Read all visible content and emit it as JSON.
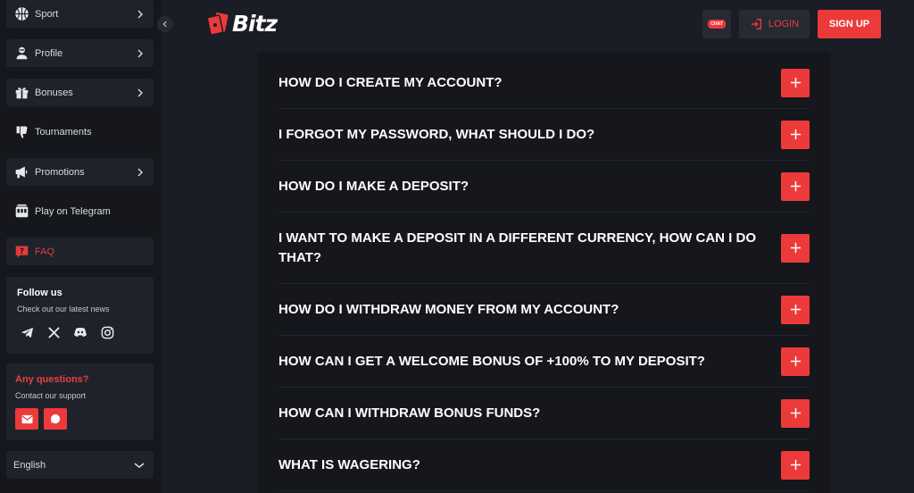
{
  "sidebar": {
    "items": [
      {
        "label": "Sport",
        "icon": "basketball-icon",
        "has_chevron": true
      },
      {
        "label": "Profile",
        "icon": "user-icon",
        "has_chevron": true
      },
      {
        "label": "Bonuses",
        "icon": "gift-icon",
        "has_chevron": true
      },
      {
        "label": "Tournaments",
        "icon": "thumbs-down-icon",
        "has_chevron": false
      },
      {
        "label": "Promotions",
        "icon": "megaphone-icon",
        "has_chevron": true
      },
      {
        "label": "Play on Telegram",
        "icon": "slot-machine-icon",
        "has_chevron": false
      },
      {
        "label": "FAQ",
        "icon": "question-icon",
        "has_chevron": false,
        "active": true
      }
    ],
    "follow": {
      "title": "Follow us",
      "subtitle": "Check out our latest news",
      "socials": [
        "telegram-icon",
        "x-icon",
        "discord-icon",
        "instagram-icon"
      ]
    },
    "questions": {
      "title": "Any questions?",
      "subtitle": "Contact our support",
      "buttons": [
        "mail-icon",
        "chat-icon"
      ]
    },
    "language": "English"
  },
  "header": {
    "logo_text": "Bitz",
    "chat_label": "CHAT",
    "login_label": "LOGIN",
    "signup_label": "SIGN UP"
  },
  "faq": {
    "questions": [
      "HOW DO I CREATE MY ACCOUNT?",
      "I FORGOT MY PASSWORD, WHAT SHOULD I DO?",
      "HOW DO I MAKE A DEPOSIT?",
      "I WANT TO MAKE A DEPOSIT IN A DIFFERENT CURRENCY, HOW CAN I DO THAT?",
      "HOW DO I WITHDRAW MONEY FROM MY ACCOUNT?",
      "HOW CAN I GET A WELCOME BONUS OF +100% TO MY DEPOSIT?",
      "HOW CAN I WITHDRAW BONUS FUNDS?",
      "WHAT IS WAGERING?"
    ]
  },
  "colors": {
    "accent": "#ec3a3a",
    "background": "#1a1d25",
    "panel": "#15171d",
    "sidebar_box": "#1f222b"
  }
}
